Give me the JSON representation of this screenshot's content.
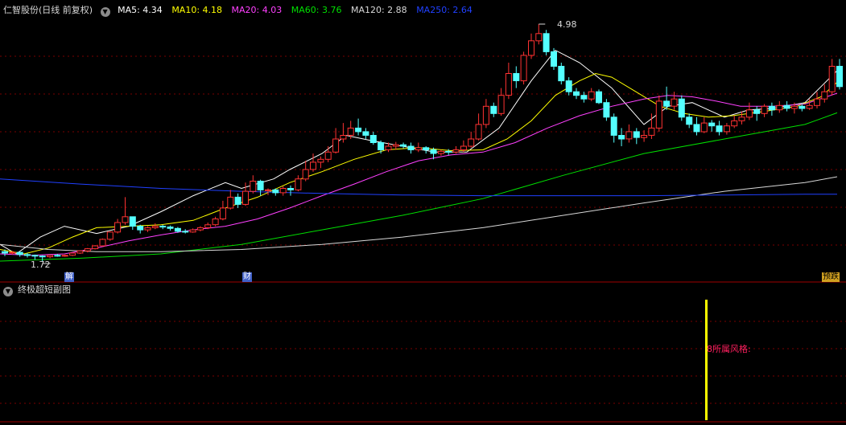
{
  "header": {
    "stock_name": "仁智股份",
    "period": "(日线 前复权)",
    "toggle_icon": "chevron-down-circle-icon",
    "ma": [
      {
        "label": "MA5: 4.34",
        "color": "#ffffff"
      },
      {
        "label": "MA10: 4.18",
        "color": "#ffff00"
      },
      {
        "label": "MA20: 4.03",
        "color": "#ff40ff"
      },
      {
        "label": "MA60: 3.76",
        "color": "#00e000"
      },
      {
        "label": "MA120: 2.88",
        "color": "#d8d8d8"
      },
      {
        "label": "MA250: 2.64",
        "color": "#2040ff"
      }
    ]
  },
  "main_chart": {
    "max_label": "4.98",
    "min_label": "1.72",
    "tags": {
      "jie": "解",
      "cai": "财",
      "yu": "预跌"
    },
    "colors": {
      "up": "#ff3232",
      "down": "#54ffff",
      "grid": "#7a0000"
    }
  },
  "sub_chart": {
    "title": "终极超短副图",
    "toggle_icon": "chevron-down-circle-icon",
    "indicator_label": "所属风格:",
    "indicator_value": "8",
    "bar_color": "#ffff00",
    "label_color": "#ff2060"
  },
  "chart_data": {
    "type": "candlestick",
    "price_range": [
      1.72,
      4.98
    ],
    "candles": [
      [
        1.85,
        1.83,
        1.88,
        1.79
      ],
      [
        1.83,
        1.84,
        1.86,
        1.81
      ],
      [
        1.84,
        1.81,
        1.85,
        1.78
      ],
      [
        1.81,
        1.8,
        1.83,
        1.77
      ],
      [
        1.8,
        1.79,
        1.81,
        1.74
      ],
      [
        1.79,
        1.78,
        1.8,
        1.72
      ],
      [
        1.78,
        1.8,
        1.81,
        1.76
      ],
      [
        1.8,
        1.79,
        1.82,
        1.78
      ],
      [
        1.79,
        1.8,
        1.81,
        1.78
      ],
      [
        1.8,
        1.83,
        1.84,
        1.79
      ],
      [
        1.83,
        1.86,
        1.87,
        1.82
      ],
      [
        1.86,
        1.89,
        1.9,
        1.84
      ],
      [
        1.89,
        1.93,
        1.94,
        1.88
      ],
      [
        1.93,
        2.02,
        2.03,
        1.92
      ],
      [
        2.02,
        2.12,
        2.13,
        2.0
      ],
      [
        2.12,
        2.25,
        2.3,
        2.1
      ],
      [
        2.25,
        2.33,
        2.6,
        2.22
      ],
      [
        2.33,
        2.2,
        2.33,
        2.15
      ],
      [
        2.2,
        2.15,
        2.22,
        2.1
      ],
      [
        2.15,
        2.18,
        2.2,
        2.12
      ],
      [
        2.18,
        2.2,
        2.24,
        2.16
      ],
      [
        2.2,
        2.19,
        2.22,
        2.16
      ],
      [
        2.19,
        2.17,
        2.21,
        2.14
      ],
      [
        2.17,
        2.13,
        2.19,
        2.11
      ],
      [
        2.13,
        2.12,
        2.16,
        2.1
      ],
      [
        2.12,
        2.15,
        2.17,
        2.11
      ],
      [
        2.15,
        2.18,
        2.2,
        2.13
      ],
      [
        2.18,
        2.22,
        2.25,
        2.16
      ],
      [
        2.22,
        2.3,
        2.33,
        2.2
      ],
      [
        2.3,
        2.45,
        2.55,
        2.28
      ],
      [
        2.45,
        2.6,
        2.7,
        2.43
      ],
      [
        2.6,
        2.5,
        2.65,
        2.45
      ],
      [
        2.5,
        2.68,
        2.8,
        2.48
      ],
      [
        2.68,
        2.82,
        2.9,
        2.65
      ],
      [
        2.82,
        2.7,
        2.84,
        2.62
      ],
      [
        2.7,
        2.7,
        2.72,
        2.63
      ],
      [
        2.7,
        2.66,
        2.72,
        2.62
      ],
      [
        2.66,
        2.72,
        2.75,
        2.62
      ],
      [
        2.72,
        2.7,
        2.76,
        2.62
      ],
      [
        2.7,
        2.85,
        2.9,
        2.68
      ],
      [
        2.85,
        2.98,
        3.1,
        2.82
      ],
      [
        2.98,
        3.08,
        3.2,
        2.95
      ],
      [
        3.08,
        3.12,
        3.16,
        3.0
      ],
      [
        3.12,
        3.22,
        3.3,
        3.08
      ],
      [
        3.22,
        3.4,
        3.55,
        3.2
      ],
      [
        3.4,
        3.45,
        3.62,
        3.35
      ],
      [
        3.45,
        3.55,
        3.65,
        3.4
      ],
      [
        3.55,
        3.5,
        3.68,
        3.45
      ],
      [
        3.5,
        3.45,
        3.55,
        3.4
      ],
      [
        3.45,
        3.35,
        3.5,
        3.32
      ],
      [
        3.35,
        3.25,
        3.38,
        3.2
      ],
      [
        3.25,
        3.3,
        3.35,
        3.22
      ],
      [
        3.3,
        3.32,
        3.36,
        3.25
      ],
      [
        3.32,
        3.3,
        3.35,
        3.27
      ],
      [
        3.3,
        3.25,
        3.35,
        3.2
      ],
      [
        3.25,
        3.28,
        3.35,
        3.22
      ],
      [
        3.28,
        3.25,
        3.3,
        3.2
      ],
      [
        3.25,
        3.2,
        3.28,
        3.12
      ],
      [
        3.2,
        3.23,
        3.25,
        3.17
      ],
      [
        3.23,
        3.22,
        3.26,
        3.18
      ],
      [
        3.22,
        3.25,
        3.3,
        3.2
      ],
      [
        3.25,
        3.3,
        3.38,
        3.22
      ],
      [
        3.3,
        3.4,
        3.5,
        3.28
      ],
      [
        3.4,
        3.6,
        3.75,
        3.38
      ],
      [
        3.6,
        3.85,
        3.95,
        3.55
      ],
      [
        3.85,
        3.75,
        3.9,
        3.7
      ],
      [
        3.75,
        4.0,
        4.1,
        3.72
      ],
      [
        4.0,
        4.3,
        4.45,
        3.95
      ],
      [
        4.3,
        4.2,
        4.4,
        4.1
      ],
      [
        4.2,
        4.55,
        4.6,
        4.15
      ],
      [
        4.55,
        4.75,
        4.85,
        4.5
      ],
      [
        4.75,
        4.85,
        4.98,
        4.7
      ],
      [
        4.85,
        4.6,
        4.9,
        4.55
      ],
      [
        4.6,
        4.4,
        4.65,
        4.35
      ],
      [
        4.4,
        4.2,
        4.45,
        4.15
      ],
      [
        4.2,
        4.05,
        4.25,
        4.0
      ],
      [
        4.05,
        4.0,
        4.1,
        3.95
      ],
      [
        4.0,
        3.95,
        4.05,
        3.9
      ],
      [
        3.95,
        4.05,
        4.1,
        3.92
      ],
      [
        4.05,
        3.9,
        4.08,
        3.88
      ],
      [
        3.9,
        3.7,
        3.95,
        3.65
      ],
      [
        3.7,
        3.45,
        3.75,
        3.35
      ],
      [
        3.45,
        3.4,
        3.55,
        3.3
      ],
      [
        3.4,
        3.5,
        3.6,
        3.35
      ],
      [
        3.5,
        3.42,
        3.55,
        3.33
      ],
      [
        3.42,
        3.45,
        3.52,
        3.36
      ],
      [
        3.45,
        3.55,
        3.75,
        3.4
      ],
      [
        3.55,
        3.92,
        4.0,
        3.5
      ],
      [
        3.92,
        3.85,
        4.12,
        3.8
      ],
      [
        3.85,
        3.95,
        4.05,
        3.8
      ],
      [
        3.95,
        3.7,
        4.0,
        3.65
      ],
      [
        3.7,
        3.6,
        3.75,
        3.55
      ],
      [
        3.6,
        3.5,
        3.7,
        3.45
      ],
      [
        3.5,
        3.62,
        3.7,
        3.48
      ],
      [
        3.62,
        3.58,
        3.66,
        3.5
      ],
      [
        3.58,
        3.5,
        3.65,
        3.45
      ],
      [
        3.5,
        3.58,
        3.62,
        3.46
      ],
      [
        3.58,
        3.65,
        3.72,
        3.55
      ],
      [
        3.65,
        3.7,
        3.78,
        3.6
      ],
      [
        3.7,
        3.8,
        3.9,
        3.66
      ],
      [
        3.8,
        3.75,
        3.85,
        3.65
      ],
      [
        3.75,
        3.85,
        3.88,
        3.7
      ],
      [
        3.85,
        3.8,
        3.9,
        3.72
      ],
      [
        3.8,
        3.86,
        3.92,
        3.76
      ],
      [
        3.86,
        3.82,
        3.92,
        3.78
      ],
      [
        3.82,
        3.85,
        3.9,
        3.75
      ],
      [
        3.85,
        3.82,
        3.88,
        3.78
      ],
      [
        3.82,
        3.86,
        3.95,
        3.8
      ],
      [
        3.86,
        3.95,
        4.05,
        3.82
      ],
      [
        3.95,
        4.05,
        4.15,
        3.9
      ],
      [
        4.05,
        4.4,
        4.5,
        4.0
      ],
      [
        4.4,
        4.12,
        4.5,
        4.08
      ]
    ],
    "ma": {
      "MA5": {
        "color": "#ffffff",
        "points": [
          [
            0,
            1.95
          ],
          [
            20,
            1.82
          ],
          [
            50,
            2.05
          ],
          [
            80,
            2.2
          ],
          [
            120,
            2.1
          ],
          [
            160,
            2.2
          ],
          [
            200,
            2.4
          ],
          [
            240,
            2.62
          ],
          [
            280,
            2.8
          ],
          [
            300,
            2.72
          ],
          [
            340,
            2.85
          ],
          [
            360,
            2.98
          ],
          [
            400,
            3.2
          ],
          [
            430,
            3.45
          ],
          [
            460,
            3.38
          ],
          [
            500,
            3.3
          ],
          [
            540,
            3.22
          ],
          [
            580,
            3.22
          ],
          [
            620,
            3.55
          ],
          [
            660,
            4.2
          ],
          [
            690,
            4.62
          ],
          [
            720,
            4.45
          ],
          [
            760,
            4.1
          ],
          [
            780,
            3.85
          ],
          [
            800,
            3.6
          ],
          [
            830,
            3.85
          ],
          [
            860,
            3.9
          ],
          [
            880,
            3.8
          ],
          [
            900,
            3.7
          ],
          [
            930,
            3.8
          ],
          [
            960,
            3.82
          ],
          [
            1000,
            3.9
          ],
          [
            1020,
            4.12
          ],
          [
            1040,
            4.34
          ]
        ]
      },
      "MA10": {
        "color": "#ffff00",
        "points": [
          [
            0,
            1.88
          ],
          [
            30,
            1.82
          ],
          [
            60,
            1.9
          ],
          [
            90,
            2.05
          ],
          [
            120,
            2.18
          ],
          [
            160,
            2.2
          ],
          [
            200,
            2.22
          ],
          [
            240,
            2.28
          ],
          [
            280,
            2.45
          ],
          [
            320,
            2.6
          ],
          [
            360,
            2.8
          ],
          [
            400,
            2.95
          ],
          [
            440,
            3.12
          ],
          [
            480,
            3.25
          ],
          [
            520,
            3.28
          ],
          [
            560,
            3.24
          ],
          [
            600,
            3.25
          ],
          [
            630,
            3.4
          ],
          [
            660,
            3.65
          ],
          [
            690,
            4.0
          ],
          [
            720,
            4.2
          ],
          [
            740,
            4.3
          ],
          [
            760,
            4.25
          ],
          [
            790,
            4.05
          ],
          [
            820,
            3.85
          ],
          [
            850,
            3.75
          ],
          [
            880,
            3.7
          ],
          [
            910,
            3.72
          ],
          [
            950,
            3.78
          ],
          [
            990,
            3.85
          ],
          [
            1020,
            3.98
          ],
          [
            1040,
            4.18
          ]
        ]
      },
      "MA20": {
        "color": "#ff40ff",
        "points": [
          [
            0,
            1.82
          ],
          [
            40,
            1.8
          ],
          [
            80,
            1.82
          ],
          [
            120,
            1.9
          ],
          [
            160,
            2.0
          ],
          [
            200,
            2.08
          ],
          [
            240,
            2.15
          ],
          [
            280,
            2.2
          ],
          [
            320,
            2.3
          ],
          [
            360,
            2.45
          ],
          [
            400,
            2.62
          ],
          [
            440,
            2.78
          ],
          [
            480,
            2.95
          ],
          [
            520,
            3.1
          ],
          [
            560,
            3.18
          ],
          [
            600,
            3.22
          ],
          [
            640,
            3.35
          ],
          [
            680,
            3.55
          ],
          [
            720,
            3.72
          ],
          [
            760,
            3.85
          ],
          [
            800,
            3.95
          ],
          [
            830,
            4.0
          ],
          [
            860,
            3.98
          ],
          [
            890,
            3.92
          ],
          [
            920,
            3.85
          ],
          [
            960,
            3.85
          ],
          [
            1000,
            3.88
          ],
          [
            1040,
            4.03
          ]
        ]
      },
      "MA60": {
        "color": "#00e000",
        "points": [
          [
            0,
            1.72
          ],
          [
            100,
            1.76
          ],
          [
            200,
            1.82
          ],
          [
            300,
            1.95
          ],
          [
            400,
            2.15
          ],
          [
            500,
            2.35
          ],
          [
            600,
            2.58
          ],
          [
            700,
            2.9
          ],
          [
            800,
            3.2
          ],
          [
            900,
            3.4
          ],
          [
            1000,
            3.6
          ],
          [
            1040,
            3.76
          ]
        ]
      },
      "MA120": {
        "color": "#d8d8d8",
        "points": [
          [
            0,
            1.95
          ],
          [
            60,
            1.88
          ],
          [
            120,
            1.85
          ],
          [
            200,
            1.85
          ],
          [
            300,
            1.88
          ],
          [
            400,
            1.95
          ],
          [
            500,
            2.05
          ],
          [
            600,
            2.18
          ],
          [
            700,
            2.35
          ],
          [
            800,
            2.52
          ],
          [
            900,
            2.68
          ],
          [
            1000,
            2.8
          ],
          [
            1040,
            2.88
          ]
        ]
      },
      "MA250": {
        "color": "#2040ff",
        "points": [
          [
            0,
            2.85
          ],
          [
            100,
            2.78
          ],
          [
            200,
            2.72
          ],
          [
            300,
            2.68
          ],
          [
            400,
            2.65
          ],
          [
            500,
            2.63
          ],
          [
            600,
            2.62
          ],
          [
            700,
            2.62
          ],
          [
            800,
            2.62
          ],
          [
            900,
            2.63
          ],
          [
            1000,
            2.64
          ],
          [
            1040,
            2.64
          ]
        ]
      }
    }
  }
}
